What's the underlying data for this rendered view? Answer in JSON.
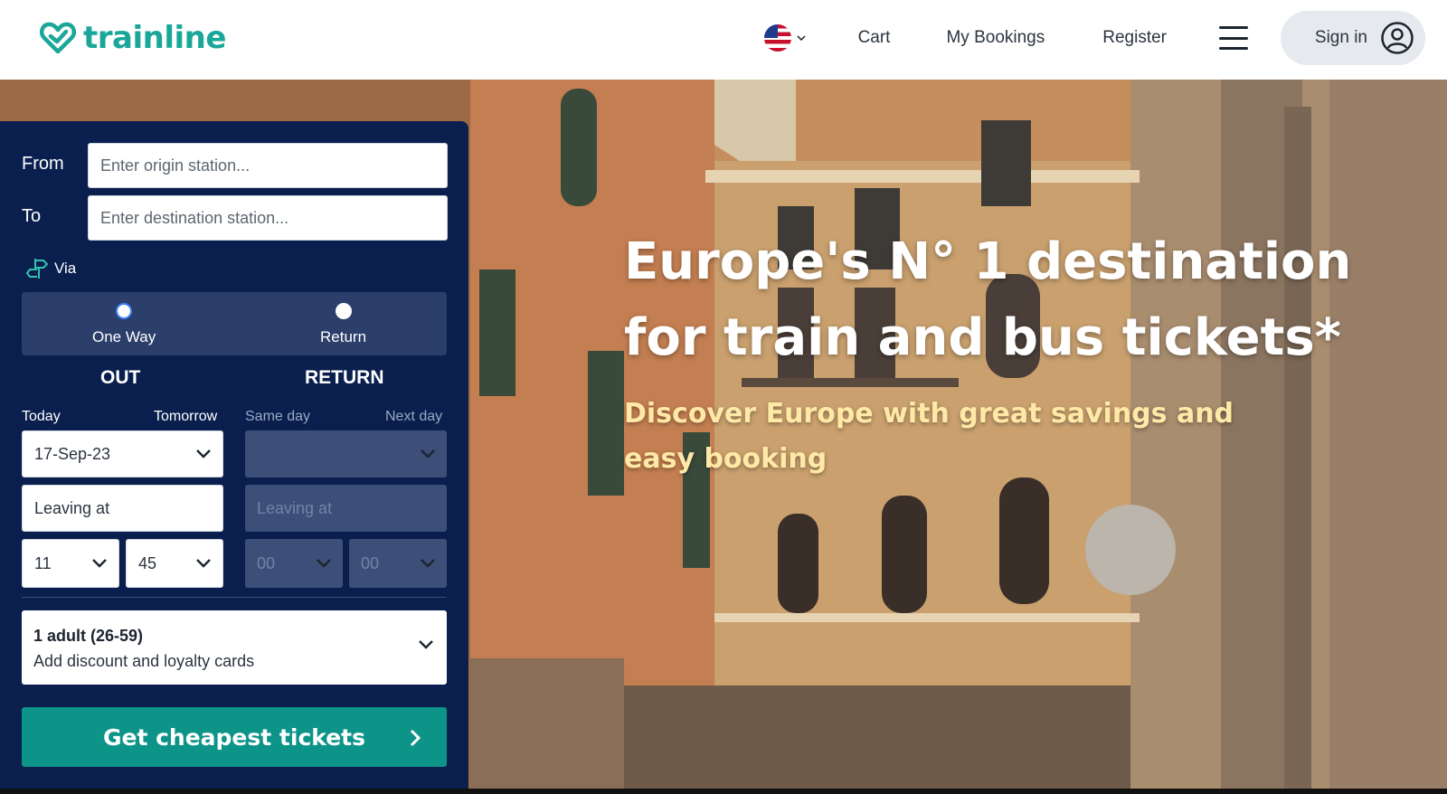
{
  "brand": {
    "name": "trainline",
    "color": "#1aa79a"
  },
  "nav": {
    "cart": "Cart",
    "bookings": "My Bookings",
    "register": "Register",
    "signin": "Sign in"
  },
  "hero": {
    "title": "Europe's N° 1 destination for train and bus tickets*",
    "subtitle": "Discover Europe with great savings and easy booking"
  },
  "search": {
    "from_label": "From",
    "from_placeholder": "Enter origin station...",
    "to_label": "To",
    "to_placeholder": "Enter destination station...",
    "via_label": "Via",
    "trip_types": {
      "one_way": "One Way",
      "return": "Return",
      "selected": "One Way"
    },
    "out": {
      "heading": "OUT",
      "today": "Today",
      "tomorrow": "Tomorrow",
      "date": "17-Sep-23",
      "leaving": "Leaving at",
      "hour": "11",
      "minute": "45"
    },
    "return": {
      "heading": "RETURN",
      "same_day": "Same day",
      "next_day": "Next day",
      "date": "",
      "leaving": "Leaving at",
      "hour": "00",
      "minute": "00"
    },
    "passengers": {
      "main": "1 adult (26-59)",
      "sub": "Add discount and loyalty cards"
    },
    "cta": "Get cheapest tickets"
  },
  "colors": {
    "panel": "#0a1f4e",
    "cta": "#0d9488",
    "subtitle": "#ffe9a6"
  }
}
